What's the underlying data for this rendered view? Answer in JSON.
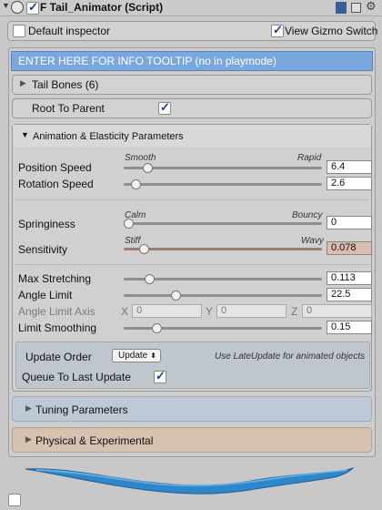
{
  "header": {
    "title": "F Tail_Animator (Script)"
  },
  "toolbar": {
    "default_inspector": "Default inspector",
    "view_gizmo": "View Gizmo Switch"
  },
  "info": {
    "text": "ENTER HERE FOR INFO TOOLTIP (no in playmode)"
  },
  "tail_bones": {
    "label": "Tail Bones (6)"
  },
  "root_to_parent": {
    "label": "Root To Parent",
    "checked": true
  },
  "anim_section": {
    "label": "Animation & Elasticity Parameters"
  },
  "sliders": {
    "position_speed": {
      "label": "Position Speed",
      "value": "6.4",
      "min_label": "Smooth",
      "max_label": "Rapid",
      "fraction": 0.1
    },
    "rotation_speed": {
      "label": "Rotation Speed",
      "value": "2.6",
      "fraction": 0.04
    },
    "springiness": {
      "label": "Springiness",
      "value": "0",
      "min_label": "Calm",
      "max_label": "Bouncy",
      "fraction": 0.0
    },
    "sensitivity": {
      "label": "Sensitivity",
      "value": "0.078",
      "min_label": "Stiff",
      "max_label": "Wavy",
      "fraction": 0.08
    },
    "max_stretching": {
      "label": "Max Stretching",
      "value": "0.113",
      "fraction": 0.11
    },
    "angle_limit": {
      "label": "Angle Limit",
      "value": "22.5",
      "fraction": 0.25
    },
    "limit_smoothing": {
      "label": "Limit Smoothing",
      "value": "0.15",
      "fraction": 0.15
    }
  },
  "angle_limit_axis": {
    "label": "Angle Limit Axis",
    "x_label": "X",
    "x": "0",
    "y_label": "Y",
    "y": "0",
    "z_label": "Z",
    "z": "0"
  },
  "update": {
    "label": "Update Order",
    "selected": "Update",
    "hint": "Use LateUpdate for animated objects"
  },
  "queue_last": {
    "label": "Queue To Last Update",
    "checked": true
  },
  "tuning": {
    "label": "Tuning Parameters"
  },
  "physical": {
    "label": "Physical & Experimental"
  },
  "colors": {
    "accent": "#7aa7dd",
    "tuning_bg": "#bdc9d6",
    "physical_bg": "#d6c2b0",
    "sensitivity_bg": "#dcbcb0",
    "tail": "#2f86c9"
  }
}
